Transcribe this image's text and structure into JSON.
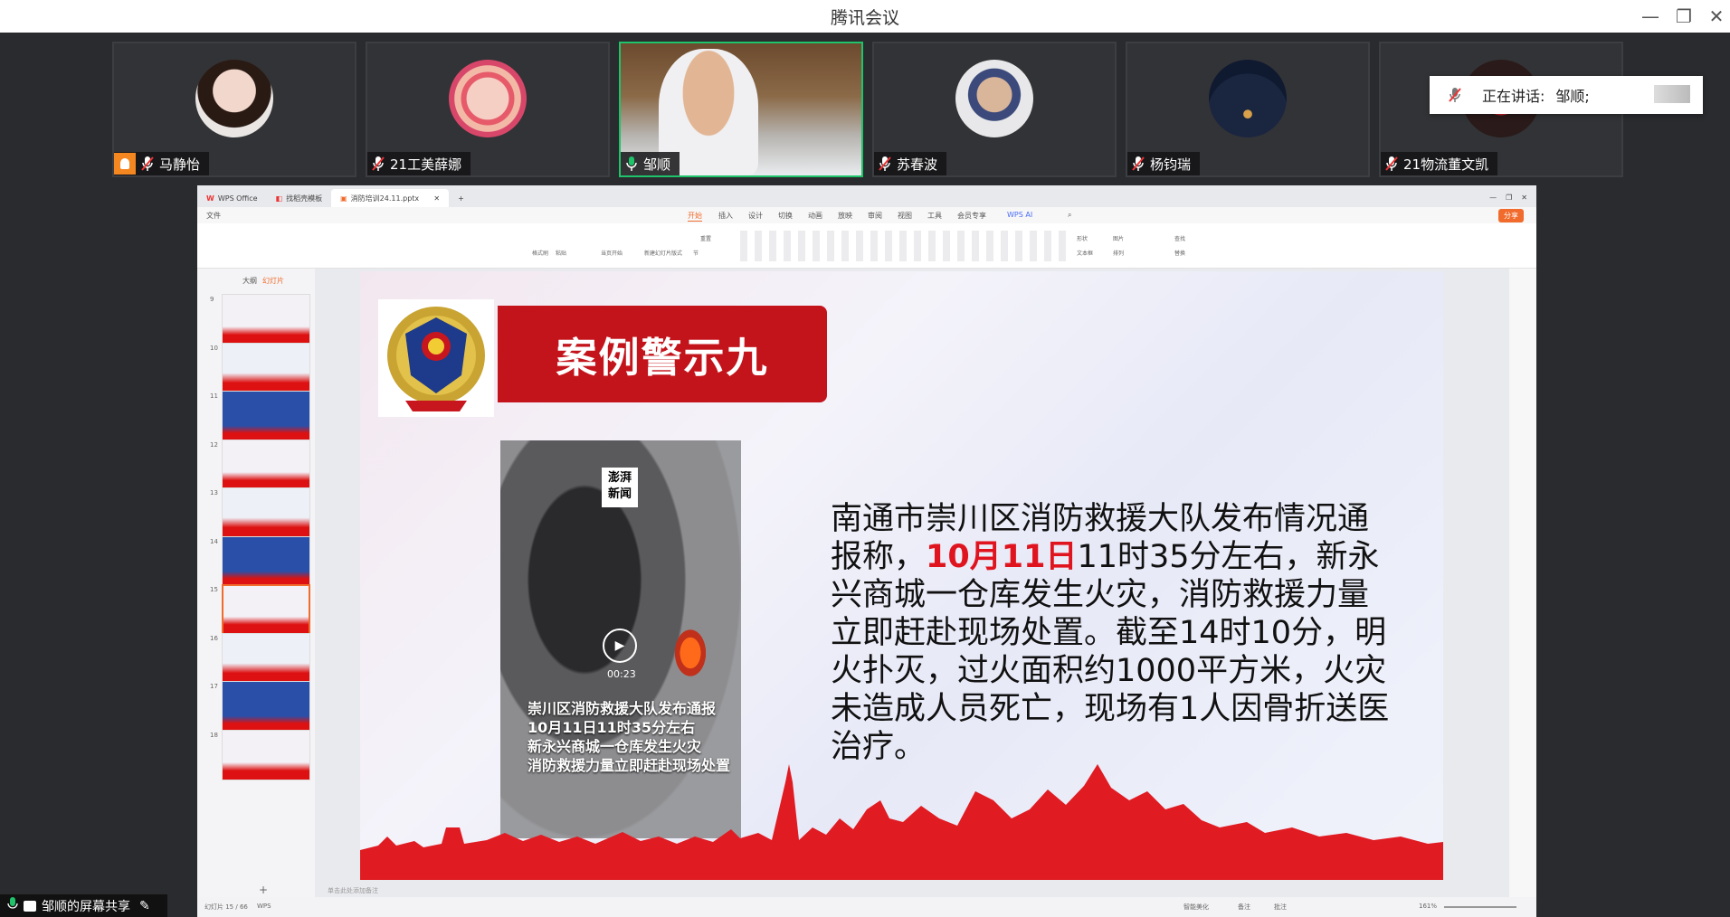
{
  "window": {
    "title": "腾讯会议"
  },
  "participants": [
    {
      "name": "马静怡",
      "muted": true,
      "host": true
    },
    {
      "name": "21工美薛娜",
      "muted": true
    },
    {
      "name": "邹顺",
      "muted": false,
      "active": true
    },
    {
      "name": "苏春波",
      "muted": true
    },
    {
      "name": "杨钧瑞",
      "muted": true
    },
    {
      "name": "21物流董文凯",
      "muted": true
    }
  ],
  "speaking": {
    "label": "正在讲话:",
    "name": "邹顺;"
  },
  "wps": {
    "tabs": [
      "WPS Office",
      "找稻壳模板",
      "消防培训24.11.pptx"
    ],
    "file_menu": "文件",
    "menus": [
      "开始",
      "插入",
      "设计",
      "切换",
      "动画",
      "放映",
      "审阅",
      "视图",
      "工具",
      "会员专享",
      "WPS AI"
    ],
    "share_button": "分享",
    "ribbon": [
      "格式刷",
      "粘贴",
      "当页开始",
      "新建幻灯片",
      "版式",
      "节",
      "重置",
      "形状",
      "图片",
      "文本框",
      "排列",
      "查找",
      "替换"
    ],
    "pane_tabs": [
      "大纲",
      "幻灯片"
    ],
    "add_slide": "+",
    "notes_placeholder": "单击此处添加备注",
    "status_left": "幻灯片 15 / 66",
    "status_app": "WPS",
    "status_right": [
      "智能美化",
      "备注",
      "批注"
    ],
    "zoom": "161%"
  },
  "thumbnails": [
    "9",
    "10",
    "11",
    "12",
    "13",
    "14",
    "15",
    "16",
    "17",
    "18"
  ],
  "selected_slide": "15",
  "slide": {
    "title": "案例警示九",
    "video_caption": [
      "崇川区消防救援大队发布通报",
      "10月11日11时35分左右",
      "新永兴商城一仓库发生火灾",
      "消防救援力量立即赶赴现场处置"
    ],
    "video_time": "00:23",
    "video_logo": [
      "澎湃",
      "新闻"
    ],
    "body_part1": "南通市崇川区消防救援大队发布情况通报称，",
    "body_highlight": "10月11日",
    "body_part2": "11时35分左右，新永兴商城一仓库发生火灾，消防救援力量立即赶赴现场处置。截至14时10分，明火扑灭，过火面积约1000平方米，火灾未造成人员死亡，现场有1人因骨折送医治疗。"
  },
  "screen_share": {
    "label": "邹顺的屏幕共享"
  }
}
